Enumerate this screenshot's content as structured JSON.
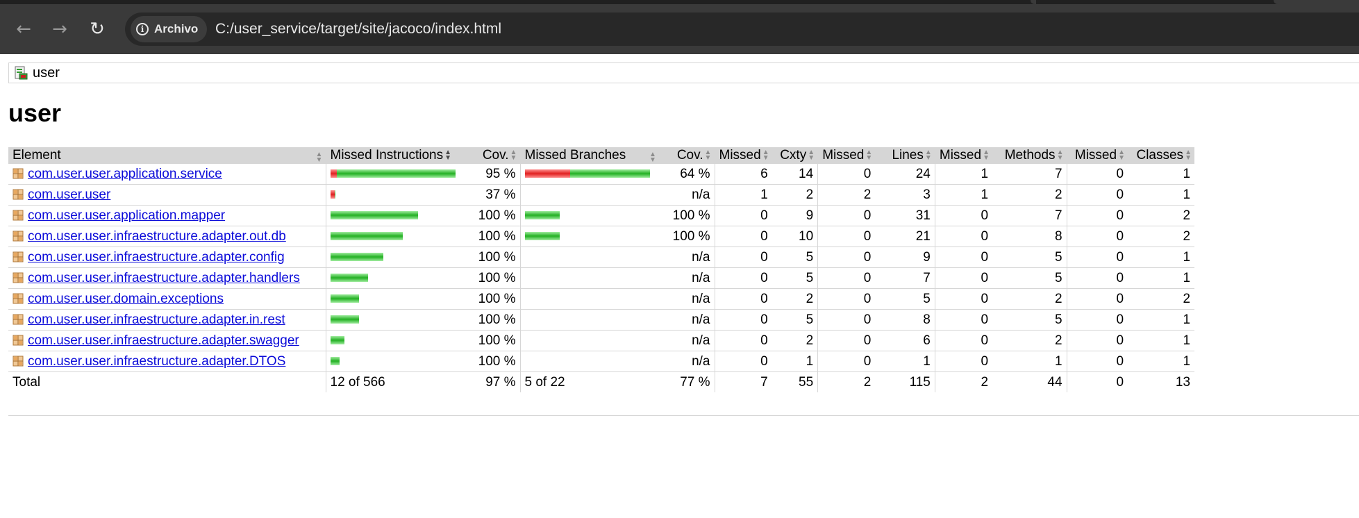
{
  "browser": {
    "back_icon": "←",
    "forward_icon": "→",
    "reload_icon": "↻",
    "site_label": "Archivo",
    "url": "C:/user_service/target/site/jacoco/index.html"
  },
  "breadcrumb": {
    "label": "user"
  },
  "page": {
    "title": "user"
  },
  "colors": {
    "bar_green": "#23b023",
    "bar_red": "#e02020",
    "link": "#0b0bd9",
    "header_bg": "#d6d6d6"
  },
  "table": {
    "headers": [
      "Element",
      "Missed Instructions",
      "Cov.",
      "Missed Branches",
      "Cov.",
      "Missed",
      "Cxty",
      "Missed",
      "Lines",
      "Missed",
      "Methods",
      "Missed",
      "Classes"
    ],
    "rows": [
      {
        "name": "com.user.user.application.service",
        "instr_missed_frac": 0.05,
        "instr_size": 1.0,
        "instr_cov": "95 %",
        "branch_missed_frac": 0.36,
        "branch_size": 1.0,
        "branch_cov": "64 %",
        "cxty_missed": "6",
        "cxty": "14",
        "lines_missed": "0",
        "lines": "24",
        "methods_missed": "1",
        "methods": "7",
        "classes_missed": "0",
        "classes": "1"
      },
      {
        "name": "com.user.user",
        "instr_missed_frac": 0.63,
        "instr_size": 0.04,
        "instr_cov": "37 %",
        "branch_missed_frac": 0,
        "branch_size": 0,
        "branch_cov": "n/a",
        "cxty_missed": "1",
        "cxty": "2",
        "lines_missed": "2",
        "lines": "3",
        "methods_missed": "1",
        "methods": "2",
        "classes_missed": "0",
        "classes": "1"
      },
      {
        "name": "com.user.user.application.mapper",
        "instr_missed_frac": 0,
        "instr_size": 0.7,
        "instr_cov": "100 %",
        "branch_missed_frac": 0,
        "branch_size": 0.28,
        "branch_cov": "100 %",
        "cxty_missed": "0",
        "cxty": "9",
        "lines_missed": "0",
        "lines": "31",
        "methods_missed": "0",
        "methods": "7",
        "classes_missed": "0",
        "classes": "2"
      },
      {
        "name": "com.user.user.infraestructure.adapter.out.db",
        "instr_missed_frac": 0,
        "instr_size": 0.58,
        "instr_cov": "100 %",
        "branch_missed_frac": 0,
        "branch_size": 0.28,
        "branch_cov": "100 %",
        "cxty_missed": "0",
        "cxty": "10",
        "lines_missed": "0",
        "lines": "21",
        "methods_missed": "0",
        "methods": "8",
        "classes_missed": "0",
        "classes": "2"
      },
      {
        "name": "com.user.user.infraestructure.adapter.config",
        "instr_missed_frac": 0,
        "instr_size": 0.42,
        "instr_cov": "100 %",
        "branch_missed_frac": 0,
        "branch_size": 0,
        "branch_cov": "n/a",
        "cxty_missed": "0",
        "cxty": "5",
        "lines_missed": "0",
        "lines": "9",
        "methods_missed": "0",
        "methods": "5",
        "classes_missed": "0",
        "classes": "1"
      },
      {
        "name": "com.user.user.infraestructure.adapter.handlers",
        "instr_missed_frac": 0,
        "instr_size": 0.3,
        "instr_cov": "100 %",
        "branch_missed_frac": 0,
        "branch_size": 0,
        "branch_cov": "n/a",
        "cxty_missed": "0",
        "cxty": "5",
        "lines_missed": "0",
        "lines": "7",
        "methods_missed": "0",
        "methods": "5",
        "classes_missed": "0",
        "classes": "1"
      },
      {
        "name": "com.user.user.domain.exceptions",
        "instr_missed_frac": 0,
        "instr_size": 0.23,
        "instr_cov": "100 %",
        "branch_missed_frac": 0,
        "branch_size": 0,
        "branch_cov": "n/a",
        "cxty_missed": "0",
        "cxty": "2",
        "lines_missed": "0",
        "lines": "5",
        "methods_missed": "0",
        "methods": "2",
        "classes_missed": "0",
        "classes": "2"
      },
      {
        "name": "com.user.user.infraestructure.adapter.in.rest",
        "instr_missed_frac": 0,
        "instr_size": 0.23,
        "instr_cov": "100 %",
        "branch_missed_frac": 0,
        "branch_size": 0,
        "branch_cov": "n/a",
        "cxty_missed": "0",
        "cxty": "5",
        "lines_missed": "0",
        "lines": "8",
        "methods_missed": "0",
        "methods": "5",
        "classes_missed": "0",
        "classes": "1"
      },
      {
        "name": "com.user.user.infraestructure.adapter.swagger",
        "instr_missed_frac": 0,
        "instr_size": 0.11,
        "instr_cov": "100 %",
        "branch_missed_frac": 0,
        "branch_size": 0,
        "branch_cov": "n/a",
        "cxty_missed": "0",
        "cxty": "2",
        "lines_missed": "0",
        "lines": "6",
        "methods_missed": "0",
        "methods": "2",
        "classes_missed": "0",
        "classes": "1"
      },
      {
        "name": "com.user.user.infraestructure.adapter.DTOS",
        "instr_missed_frac": 0,
        "instr_size": 0.07,
        "instr_cov": "100 %",
        "branch_missed_frac": 0,
        "branch_size": 0,
        "branch_cov": "n/a",
        "cxty_missed": "0",
        "cxty": "1",
        "lines_missed": "0",
        "lines": "1",
        "methods_missed": "0",
        "methods": "1",
        "classes_missed": "0",
        "classes": "1"
      }
    ],
    "total": {
      "label": "Total",
      "instr": "12 of 566",
      "instr_cov": "97 %",
      "branch": "5 of 22",
      "branch_cov": "77 %",
      "cxty_missed": "7",
      "cxty": "55",
      "lines_missed": "2",
      "lines": "115",
      "methods_missed": "2",
      "methods": "44",
      "classes_missed": "0",
      "classes": "13"
    }
  }
}
